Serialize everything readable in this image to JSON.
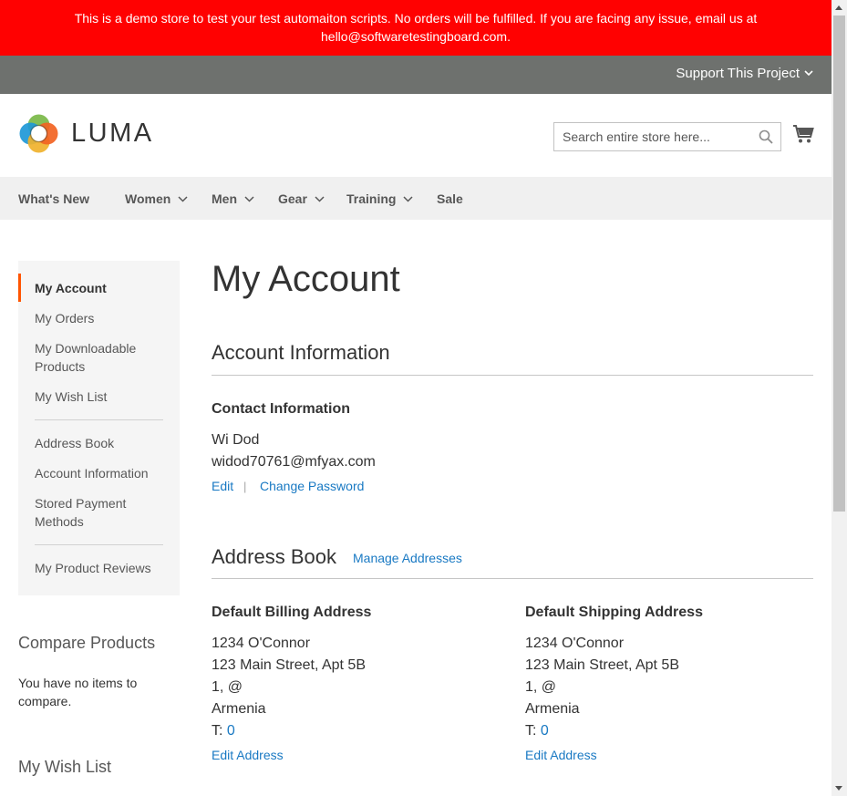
{
  "banner": {
    "line1": "This is a demo store to test your test automaiton scripts. No orders will be fulfilled. If you are facing any issue, email us at",
    "line2": "hello@softwaretestingboard.com."
  },
  "panel": {
    "support_label": "Support This Project"
  },
  "header": {
    "logo_text": "LUMA",
    "search_placeholder": "Search entire store here...",
    "logo_colors": [
      "#f26322",
      "#f0b22c",
      "#79b948",
      "#1e98d7"
    ]
  },
  "nav": {
    "items": [
      {
        "label": "What's New",
        "has_dropdown": false
      },
      {
        "label": "Women",
        "has_dropdown": true
      },
      {
        "label": "Men",
        "has_dropdown": true
      },
      {
        "label": "Gear",
        "has_dropdown": true
      },
      {
        "label": "Training",
        "has_dropdown": true
      },
      {
        "label": "Sale",
        "has_dropdown": false
      }
    ]
  },
  "sidebar": {
    "items": [
      {
        "label": "My Account",
        "active": true
      },
      {
        "label": "My Orders"
      },
      {
        "label": "My Downloadable Products"
      },
      {
        "label": "My Wish List"
      },
      {
        "label": "Address Book"
      },
      {
        "label": "Account Information"
      },
      {
        "label": "Stored Payment Methods"
      },
      {
        "label": "My Product Reviews"
      }
    ],
    "compare_title": "Compare Products",
    "compare_empty": "You have no items to compare.",
    "wishlist_title": "My Wish List"
  },
  "main": {
    "page_title": "My Account",
    "account_info_title": "Account Information",
    "contact_title": "Contact Information",
    "contact_name": "Wi Dod",
    "contact_email": "widod70761@mfyax.com",
    "edit_label": "Edit",
    "separator": "|",
    "change_password_label": "Change Password",
    "address_book_title": "Address Book",
    "manage_addresses_label": "Manage Addresses",
    "billing": {
      "title": "Default Billing Address",
      "name": "1234 O'Connor",
      "street": "123 Main Street, Apt 5B",
      "city": "1, @",
      "country": "Armenia",
      "phone_prefix": "T:",
      "phone": "0",
      "edit_label": "Edit Address"
    },
    "shipping": {
      "title": "Default Shipping Address",
      "name": "1234 O'Connor",
      "street": "123 Main Street, Apt 5B",
      "city": "1, @",
      "country": "Armenia",
      "phone_prefix": "T:",
      "phone": "0",
      "edit_label": "Edit Address"
    }
  }
}
